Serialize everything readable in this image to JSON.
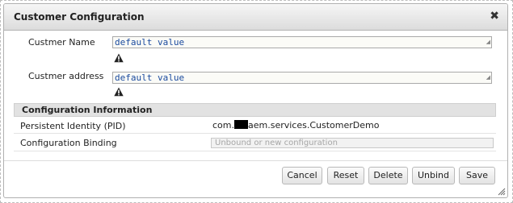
{
  "dialog": {
    "title": "Customer Configuration",
    "close_glyph": "✖"
  },
  "fields": [
    {
      "label": "Custmer Name",
      "value": "default value"
    },
    {
      "label": "Custmer address",
      "value": "default value"
    }
  ],
  "icons": {
    "warning": "warning-icon",
    "close": "close-icon",
    "resize": "resize-grip-icon"
  },
  "config_info": {
    "heading": "Configuration Information",
    "pid_label": "Persistent Identity (PID)",
    "pid_prefix": "com.",
    "pid_suffix": "aem.services.CustomerDemo",
    "binding_label": "Configuration Binding",
    "binding_placeholder": "Unbound or new configuration"
  },
  "buttons": {
    "cancel": "Cancel",
    "reset": "Reset",
    "delete": "Delete",
    "unbind": "Unbind",
    "save": "Save"
  },
  "colors": {
    "title_bar": "#e6e6e6",
    "section_header": "#e2e2e2",
    "input_text": "#1a4a9e"
  }
}
